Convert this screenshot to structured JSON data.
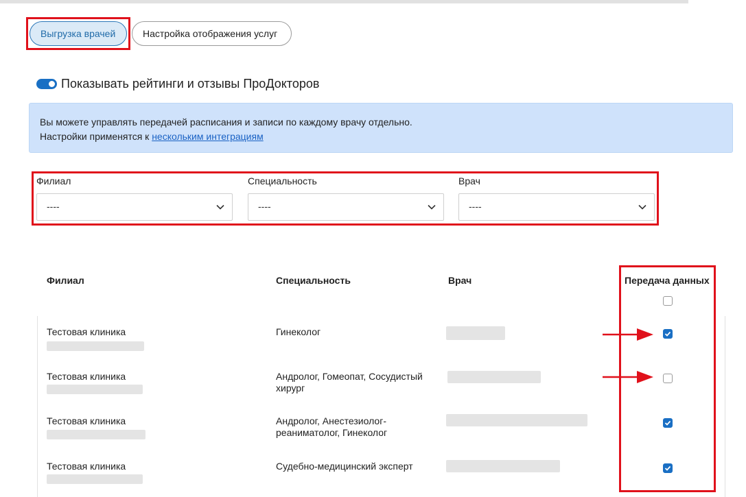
{
  "tabs": [
    {
      "label": "Выгрузка врачей",
      "active": true
    },
    {
      "label": "Настройка отображения услуг",
      "active": false
    }
  ],
  "toggle": {
    "label": "Показывать рейтинги и отзывы ПроДокторов",
    "on": true
  },
  "alert": {
    "line1": "Вы можете управлять передачей расписания и записи по каждому врачу отдельно.",
    "line2_prefix": "Настройки применятся к ",
    "line2_link": "нескольким интеграциям"
  },
  "filters": [
    {
      "label": "Филиал",
      "value": "----"
    },
    {
      "label": "Специальность",
      "value": "----"
    },
    {
      "label": "Врач",
      "value": "----"
    }
  ],
  "table": {
    "headers": [
      "Филиал",
      "Специальность",
      "Врач",
      "Передача данных"
    ],
    "header_checkbox": false,
    "rows": [
      {
        "branch": "Тестовая клиника",
        "specialty": "Гинеколог",
        "transfer": true
      },
      {
        "branch": "Тестовая клиника",
        "specialty": "Андролог, Гомеопат, Сосудистый хирург",
        "transfer": false
      },
      {
        "branch": "Тестовая клиника",
        "specialty": "Андролог, Анестезиолог-реаниматолог, Гинеколог",
        "transfer": true
      },
      {
        "branch": "Тестовая клиника",
        "specialty": "Судебно-медицинский эксперт",
        "transfer": true
      }
    ]
  },
  "colors": {
    "accent": "#1a6fc4",
    "annotation_red": "#e0111b",
    "alert_bg": "#cfe2fb"
  }
}
